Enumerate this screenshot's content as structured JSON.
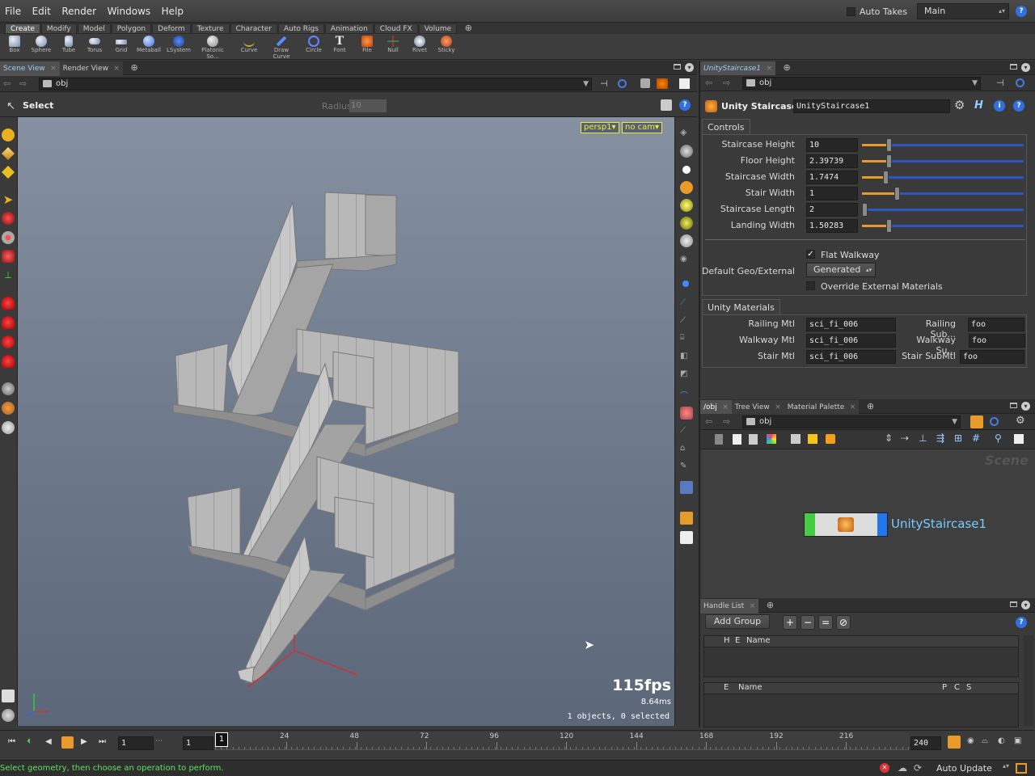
{
  "menu": [
    "File",
    "Edit",
    "Render",
    "Windows",
    "Help"
  ],
  "auto_takes": {
    "label": "Auto Takes",
    "checked": false
  },
  "desktop": "Main",
  "shelf_tabs": [
    "Create",
    "Modify",
    "Model",
    "Polygon",
    "Deform",
    "Texture",
    "Character",
    "Auto Rigs",
    "Animation",
    "Cloud FX",
    "Volume"
  ],
  "shelf_tools": [
    "Box",
    "Sphere",
    "Tube",
    "Torus",
    "Grid",
    "Metaball",
    "LSystem",
    "Platonic So...",
    "Curve",
    "Draw Curve",
    "Circle",
    "Font",
    "File",
    "Null",
    "Rivet",
    "Sticky"
  ],
  "left_pane": {
    "tabs": [
      "Scene View",
      "Render View"
    ],
    "path": "obj",
    "tool_name": "Select",
    "radius_label": "Radius",
    "radius_value": "10",
    "camera": "persp1▾",
    "cam": "no cam▾",
    "fps": "115fps",
    "ms": "8.64ms",
    "selection": "1 objects, 0 selected"
  },
  "params": {
    "tab": "UnityStaircase1",
    "path": "obj",
    "node_type": "Unity Staircase",
    "node_name": "UnityStaircase1",
    "section_controls": "Controls",
    "sliders": [
      {
        "label": "Staircase Height",
        "value": "10",
        "pos": 0.15
      },
      {
        "label": "Floor Height",
        "value": "2.39739",
        "pos": 0.15
      },
      {
        "label": "Staircase Width",
        "value": "1.7474",
        "pos": 0.13
      },
      {
        "label": "Stair Width",
        "value": "1",
        "pos": 0.2
      },
      {
        "label": "Staircase Length",
        "value": "2",
        "pos": 0.0
      },
      {
        "label": "Landing Width",
        "value": "1.50283",
        "pos": 0.15
      }
    ],
    "flat_walkway": {
      "label": "Flat Walkway",
      "checked": true
    },
    "geo_label": "Default Geo/External",
    "geo_value": "Generated",
    "override": {
      "label": "Override External Materials",
      "checked": false
    },
    "section_materials": "Unity Materials",
    "materials": [
      {
        "label": "Railing Mtl",
        "value": "sci_fi_006",
        "sub_label": "Railing Sub...",
        "sub_value": "foo"
      },
      {
        "label": "Walkway Mtl",
        "value": "sci_fi_006",
        "sub_label": "Walkway Su...",
        "sub_value": "foo"
      },
      {
        "label": "Stair Mtl",
        "value": "sci_fi_006",
        "sub_label": "Stair SubMtl",
        "sub_value": "foo"
      }
    ]
  },
  "network": {
    "tabs": [
      "/obj",
      "Tree View",
      "Material Palette"
    ],
    "path": "obj",
    "watermark": "Scene",
    "node_label": "UnityStaircase1"
  },
  "handles": {
    "tab": "Handle List",
    "add_group": "Add Group",
    "cols1": [
      "H",
      "E",
      "Name"
    ],
    "cols2": [
      "E",
      "Name",
      "P",
      "C",
      "S"
    ]
  },
  "timeline": {
    "frame": "1",
    "start": "1",
    "current": "1",
    "end": "240",
    "ticks": [
      "24",
      "48",
      "72",
      "96",
      "120",
      "144",
      "168",
      "192",
      "216"
    ]
  },
  "status": {
    "message": "Select geometry, then choose an operation to perform.",
    "update": "Auto Update"
  }
}
